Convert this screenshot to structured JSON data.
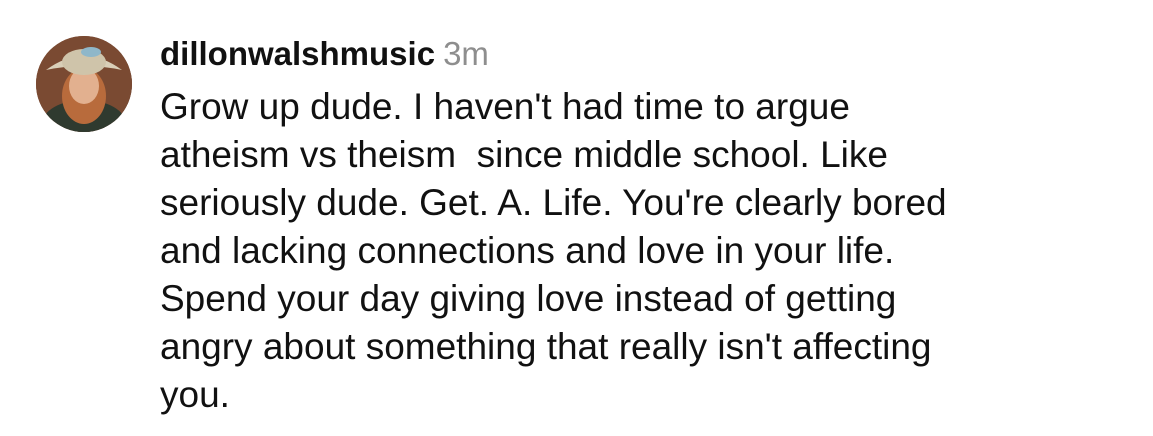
{
  "comment": {
    "username": "dillonwalshmusic",
    "timestamp": "3m",
    "avatar_icon": "user-avatar-photo-icon",
    "body_lines": [
      "Grow up dude. I haven't had time to argue",
      "atheism vs theism  since middle school. Like",
      "seriously dude. Get. A. Life. You're clearly bored",
      "and lacking connections and love in your life.",
      "Spend your day giving love instead of getting",
      "angry about something that really isn't affecting",
      "you."
    ]
  }
}
